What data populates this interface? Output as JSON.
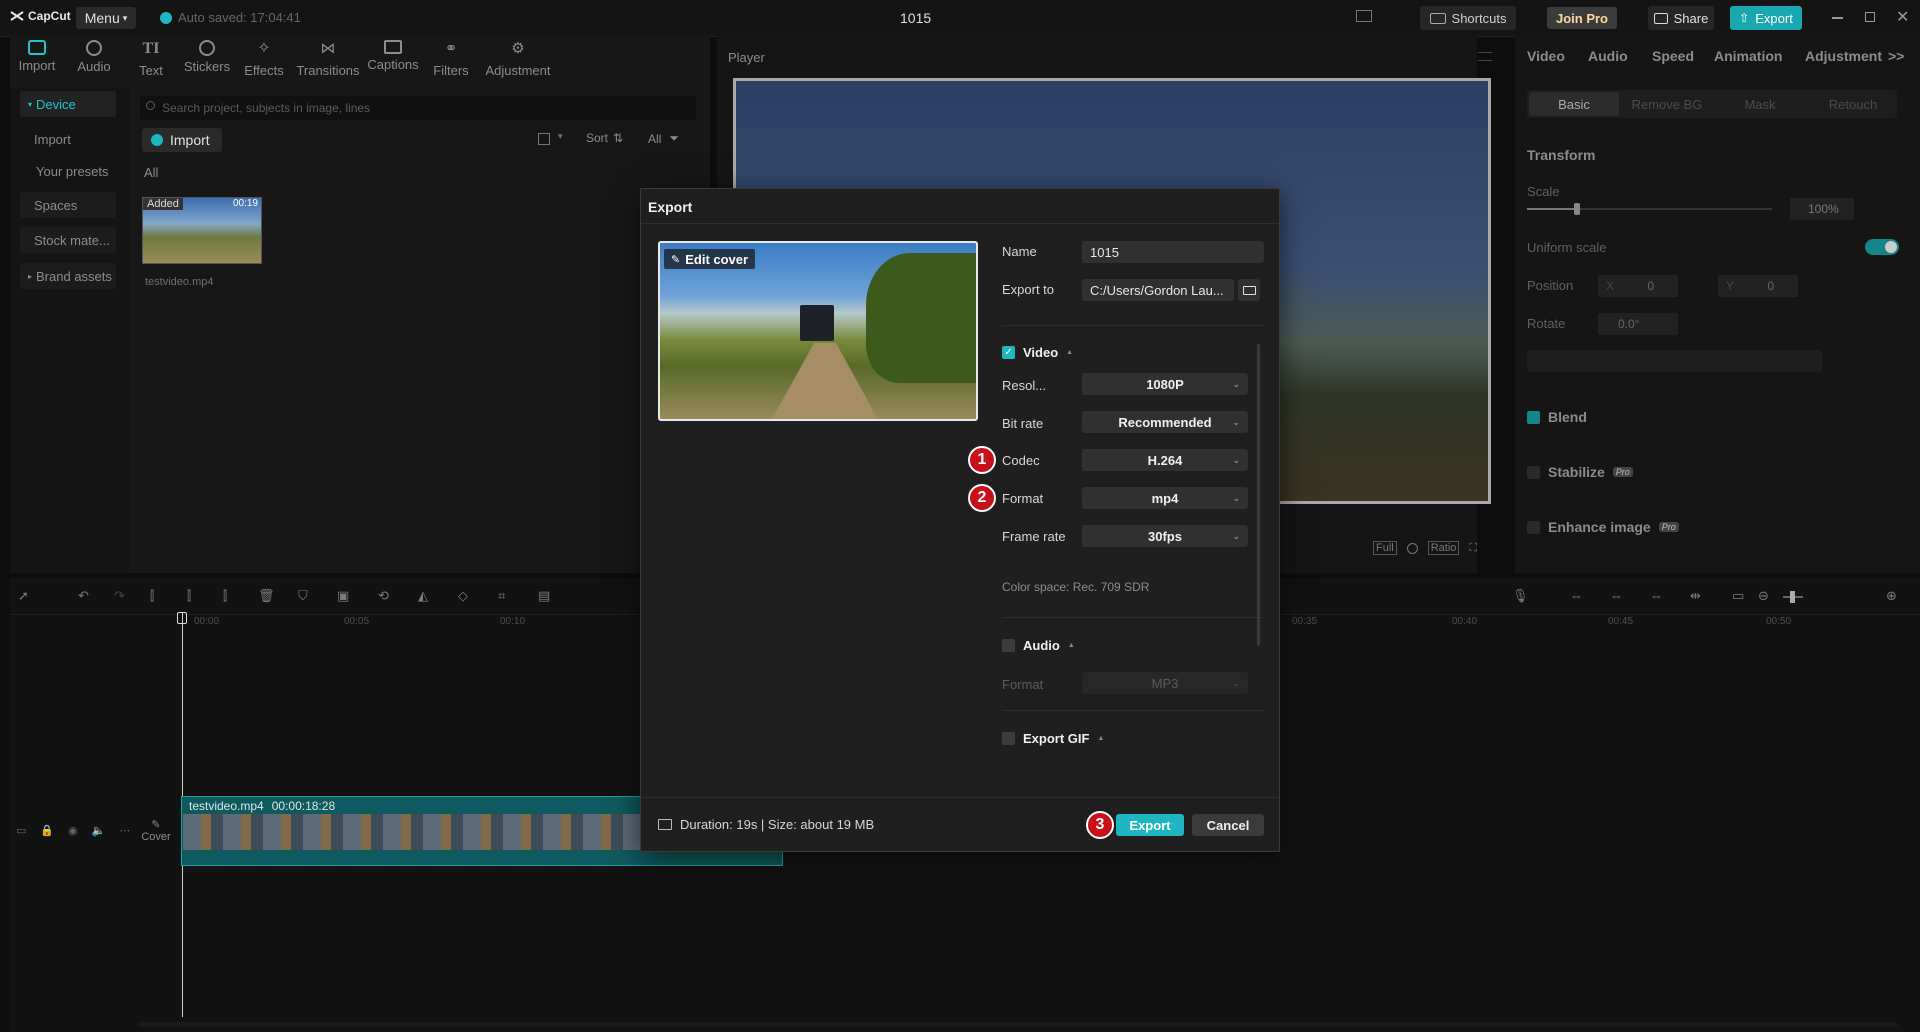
{
  "app": {
    "logo": "CapCut",
    "menu_label": "Menu",
    "autosave": "Auto saved: 17:04:41",
    "project_title": "1015",
    "shortcuts_label": "Shortcuts",
    "join_pro_label": "Join Pro",
    "share_label": "Share",
    "export_label": "Export"
  },
  "toolbar": {
    "tools": [
      "Import",
      "Audio",
      "Text",
      "Stickers",
      "Effects",
      "Transitions",
      "Captions",
      "Filters",
      "Adjustment"
    ]
  },
  "media": {
    "nav": [
      "Device",
      "Import",
      "Your presets",
      "Spaces",
      "Stock mate...",
      "Brand assets"
    ],
    "search_placeholder": "Search project, subjects in image, lines",
    "import_label": "Import",
    "sort_label": "Sort",
    "all_filter": "All",
    "all_label": "All",
    "thumb_badge": "Added",
    "thumb_duration": "00:19",
    "thumb_name": "testvideo.mp4"
  },
  "player": {
    "title": "Player",
    "controls": [
      "Full",
      "Ratio"
    ]
  },
  "inspector": {
    "tabs": [
      "Video",
      "Audio",
      "Speed",
      "Animation",
      "Adjustment"
    ],
    "subtabs": [
      "Basic",
      "Remove BG",
      "Mask",
      "Retouch"
    ],
    "transform": "Transform",
    "scale_label": "Scale",
    "scale_value": "100%",
    "uniform_scale": "Uniform scale",
    "position_label": "Position",
    "pos_x_label": "X",
    "pos_x": "0",
    "pos_y_label": "Y",
    "pos_y": "0",
    "rotate_label": "Rotate",
    "rotate_value": "0.0°",
    "blend": "Blend",
    "stabilize": "Stabilize",
    "enhance": "Enhance image",
    "pro_badge": "Pro"
  },
  "timeline": {
    "ticks": [
      "00:00",
      "00:05",
      "00:10",
      "00:35",
      "00:40",
      "00:45",
      "00:50"
    ],
    "clip_name": "testvideo.mp4",
    "clip_duration": "00:00:18:28",
    "cover_label": "Cover"
  },
  "dialog": {
    "title": "Export",
    "edit_cover": "Edit cover",
    "name_label": "Name",
    "name_value": "1015",
    "export_to_label": "Export to",
    "export_to_value": "C:/Users/Gordon Lau...",
    "video_section": "Video",
    "resolution_label": "Resol...",
    "resolution_value": "1080P",
    "bitrate_label": "Bit rate",
    "bitrate_value": "Recommended",
    "codec_label": "Codec",
    "codec_value": "H.264",
    "format_label": "Format",
    "format_value": "mp4",
    "framerate_label": "Frame rate",
    "framerate_value": "30fps",
    "color_space": "Color space: Rec. 709 SDR",
    "audio_section": "Audio",
    "audio_format_label": "Format",
    "audio_format_value": "MP3",
    "gif_section": "Export GIF",
    "footer_info": "Duration: 19s | Size: about 19 MB",
    "export_button": "Export",
    "cancel_button": "Cancel"
  },
  "annotations": {
    "badge1": "1",
    "badge2": "2",
    "badge3": "3"
  },
  "colors": {
    "accent": "#1fb6c1",
    "badge": "#c8101a",
    "background": "#0d0d0d"
  }
}
